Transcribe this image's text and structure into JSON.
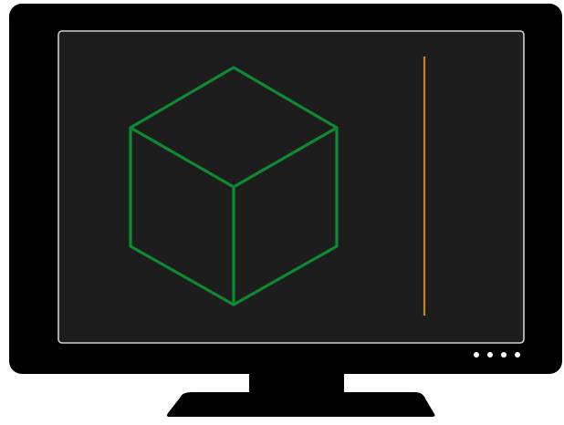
{
  "colors": {
    "page_background": "#ffffff",
    "monitor_body": "#000000",
    "screen_background": "#1d1d1d",
    "screen_border": "#cfcfcf",
    "cube_stroke": "#0e8a32",
    "vertical_line": "#c8841e",
    "indicator_dots": "#ffffff"
  },
  "icons": {
    "cube": "cube-wireframe-icon",
    "indicators": "status-dots-icon"
  },
  "indicator_count": 4
}
